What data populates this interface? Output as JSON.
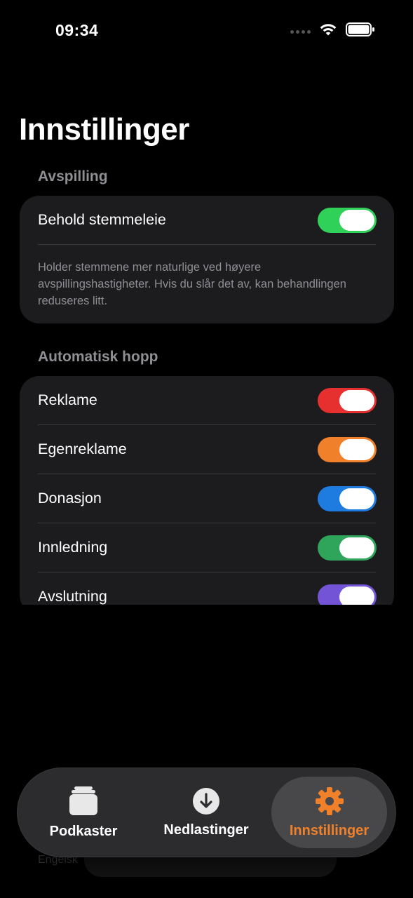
{
  "status_bar": {
    "time": "09:34"
  },
  "page": {
    "title": "Innstillinger"
  },
  "sections": {
    "playback": {
      "header": "Avspilling",
      "rows": [
        {
          "label": "Behold stemmeleie",
          "toggle_on": true,
          "color": "#30d158"
        }
      ],
      "footnote": "Holder stemmene mer naturlige ved høyere avspillingshastigheter. Hvis du slår det av, kan behandlingen reduseres litt."
    },
    "auto_skip": {
      "header": "Automatisk hopp",
      "rows": [
        {
          "label": "Reklame",
          "toggle_on": true,
          "color": "#e5302f"
        },
        {
          "label": "Egenreklame",
          "toggle_on": true,
          "color": "#f0802a"
        },
        {
          "label": "Donasjon",
          "toggle_on": true,
          "color": "#1e7be0"
        },
        {
          "label": "Innledning",
          "toggle_on": true,
          "color": "#2ea55a"
        },
        {
          "label": "Avslutning",
          "toggle_on": true,
          "color": "#7353d6"
        }
      ]
    }
  },
  "behind_tab_text": "Engelsk",
  "tab_bar": {
    "accent": "#f0802a",
    "tabs": [
      {
        "label": "Podkaster",
        "icon": "stack-icon",
        "active": false
      },
      {
        "label": "Nedlastinger",
        "icon": "download-icon",
        "active": false
      },
      {
        "label": "Innstillinger",
        "icon": "gear-icon",
        "active": true
      }
    ]
  }
}
